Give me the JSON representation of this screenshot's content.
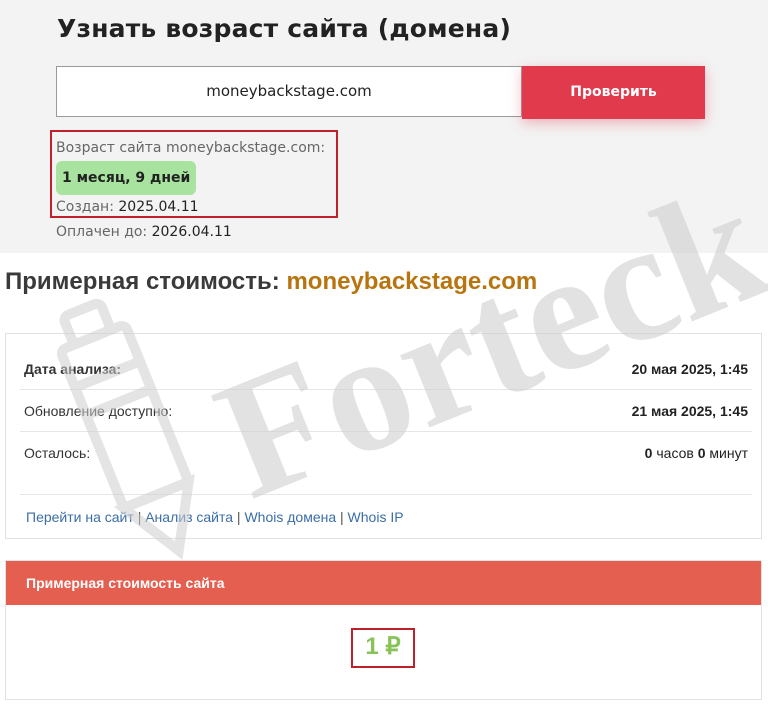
{
  "top": {
    "title": "Узнать возраст сайта (домена)",
    "domain_value": "moneybackstage.com",
    "check_button": "Проверить",
    "age_label": "Возраст сайта moneybackstage.com:",
    "age_value": "1 месяц, 9 дней",
    "created_label": "Создан:",
    "created_value": "2025.04.11",
    "paid_label": "Оплачен до:",
    "paid_value": "2026.04.11"
  },
  "cost": {
    "title_prefix": "Примерная стоимость:",
    "title_domain": "moneybackstage.com",
    "rows": [
      {
        "label": "Дата анализа:",
        "value": "20 мая 2025, 1:45"
      },
      {
        "label": "Обновление доступно:",
        "value": "21 мая 2025, 1:45"
      },
      {
        "label": "Осталось:",
        "hours": "0",
        "hours_unit": "часов",
        "minutes": "0",
        "minutes_unit": "минут"
      }
    ],
    "links": [
      "Перейти на сайт",
      "Анализ сайта",
      "Whois домена",
      "Whois IP"
    ],
    "separator": "|",
    "price_header": "Примерная стоимость сайта",
    "price_value": "1 ₽"
  },
  "watermark": {
    "text": "Forteck",
    "color": "#d8d8d8"
  },
  "colors": {
    "accent_red": "#e03a4c",
    "header_red": "#e45f50",
    "badge_green": "#a8e4a0",
    "price_green": "#8ac25a",
    "domain_orange": "#b8750f",
    "link_blue": "#3b6ea8"
  }
}
